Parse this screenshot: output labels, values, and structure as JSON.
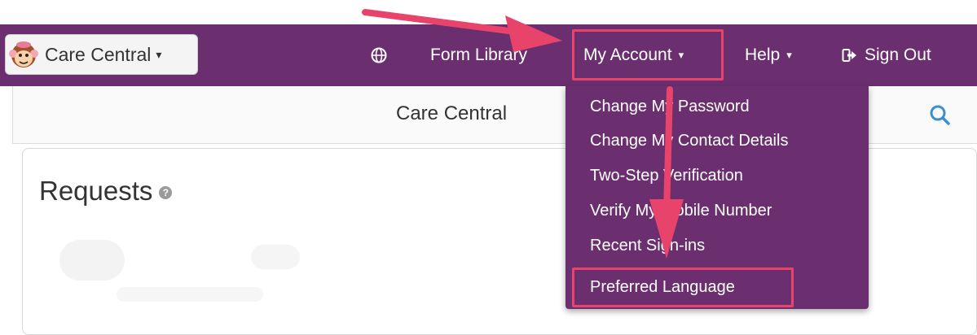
{
  "brand": {
    "label": "Care Central",
    "icon": "monkey-logo-icon"
  },
  "nav": {
    "globe_icon": "globe-icon",
    "form_library": "Form Library",
    "my_account": "My Account",
    "help": "Help",
    "sign_out": "Sign Out",
    "sign_out_icon": "sign-out-icon"
  },
  "subbar": {
    "title": "Care Central",
    "search_icon": "search-icon"
  },
  "panel": {
    "title": "Requests",
    "help_icon": "question-circle-icon"
  },
  "account_menu": {
    "items": [
      "Change My Password",
      "Change My Contact Details",
      "Two-Step Verification",
      "Verify My Mobile Number",
      "Recent Sign-ins",
      "Preferred Language"
    ]
  },
  "colors": {
    "navbar": "#6b2f6f",
    "highlight": "#e8446b",
    "search_icon": "#3a8fd0"
  }
}
